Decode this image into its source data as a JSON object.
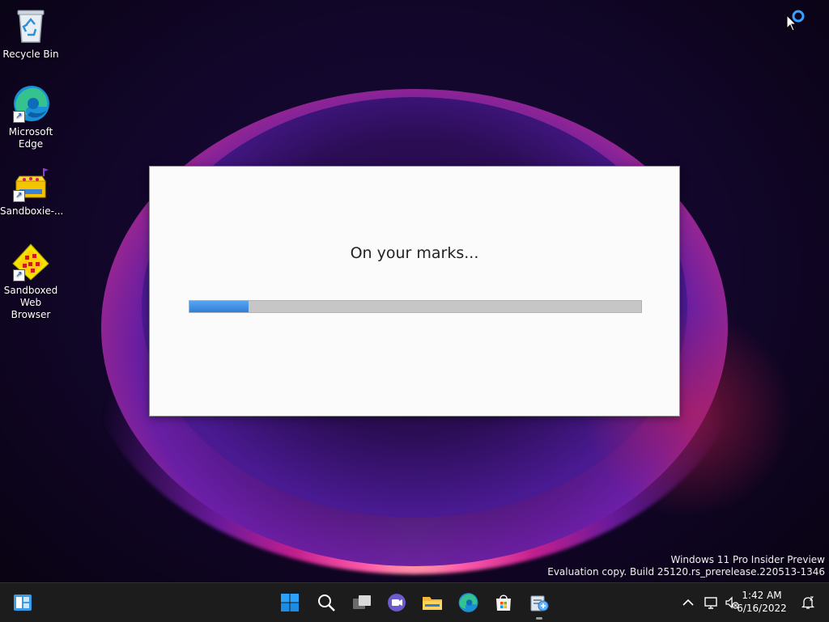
{
  "desktop": {
    "icons": [
      {
        "label": "Recycle Bin",
        "icon": "recycle-bin-icon"
      },
      {
        "label": "Microsoft Edge",
        "icon": "edge-icon"
      },
      {
        "label": "Sandboxie-...",
        "icon": "sandboxie-icon"
      },
      {
        "label": "Sandboxed Web Browser",
        "icon": "sandboxed-browser-icon"
      }
    ]
  },
  "dialog": {
    "title": "On your marks...",
    "progress_fraction": 0.13
  },
  "watermark": {
    "line1": "Windows 11 Pro Insider Preview",
    "line2": "Evaluation copy. Build 25120.rs_prerelease.220513-1346"
  },
  "taskbar": {
    "apps": [
      "widgets-icon",
      "start-icon",
      "search-icon",
      "task-view-icon",
      "teams-chat-icon",
      "file-explorer-icon",
      "edge-icon",
      "store-icon",
      "sandboxie-control-icon"
    ],
    "time": "1:42 AM",
    "date": "6/16/2022"
  },
  "colors": {
    "accent": "#2f7fd8",
    "taskbar": "#1c1c1c"
  }
}
